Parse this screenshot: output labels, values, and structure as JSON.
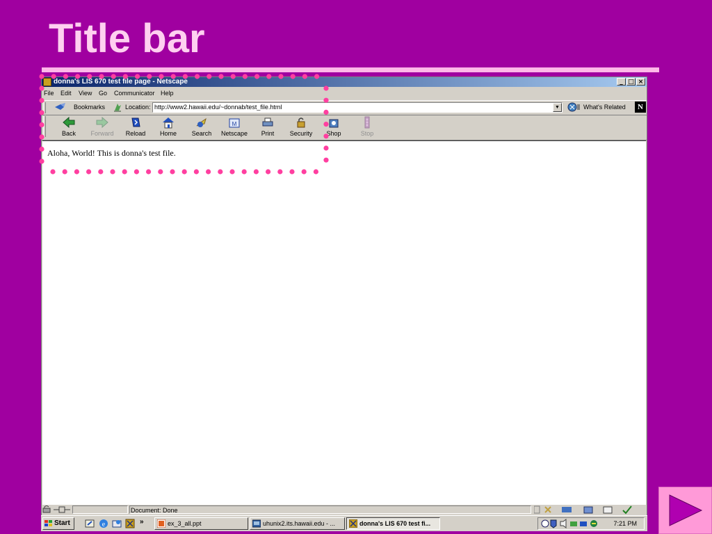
{
  "slide": {
    "title": "Title bar"
  },
  "browser": {
    "window_title": "donna's LIS 670 test file page - Netscape",
    "window_controls": [
      "_",
      "□",
      "×"
    ],
    "menu": [
      "File",
      "Edit",
      "View",
      "Go",
      "Communicator",
      "Help"
    ],
    "location_bar": {
      "bookmarks_label": "Bookmarks",
      "location_label": "Location:",
      "url": "http://www2.hawaii.edu/~donnab/test_file.html",
      "whats_related_label": "What's Related",
      "brand_letter": "N"
    },
    "nav_buttons": [
      {
        "label": "Back",
        "icon": "back-arrow-icon",
        "enabled": true
      },
      {
        "label": "Forward",
        "icon": "forward-arrow-icon",
        "enabled": false
      },
      {
        "label": "Reload",
        "icon": "reload-icon",
        "enabled": true
      },
      {
        "label": "Home",
        "icon": "home-icon",
        "enabled": true
      },
      {
        "label": "Search",
        "icon": "search-icon",
        "enabled": true
      },
      {
        "label": "Netscape",
        "icon": "netscape-icon",
        "enabled": true
      },
      {
        "label": "Print",
        "icon": "print-icon",
        "enabled": true
      },
      {
        "label": "Security",
        "icon": "security-lock-icon",
        "enabled": true
      },
      {
        "label": "Shop",
        "icon": "shop-icon",
        "enabled": true
      },
      {
        "label": "Stop",
        "icon": "stop-icon",
        "enabled": false
      }
    ],
    "page_content": "Aloha, World! This is donna's test file.",
    "status_text": "Document: Done"
  },
  "taskbar": {
    "start_label": "Start",
    "chevron": "»",
    "tasks": [
      {
        "label": "ex_3_all.ppt",
        "active": false
      },
      {
        "label": "uhunix2.its.hawaii.edu - ...",
        "active": false
      },
      {
        "label": "donna's LIS 670 test fi...",
        "active": true
      }
    ],
    "clock": "7:21 PM"
  },
  "colors": {
    "slide_background": "#a000a0",
    "title_text": "#ffd0f0",
    "highlight_dots": "#ff3fa0",
    "next_button": "#ff9ad8",
    "next_arrow": "#b000b0"
  }
}
